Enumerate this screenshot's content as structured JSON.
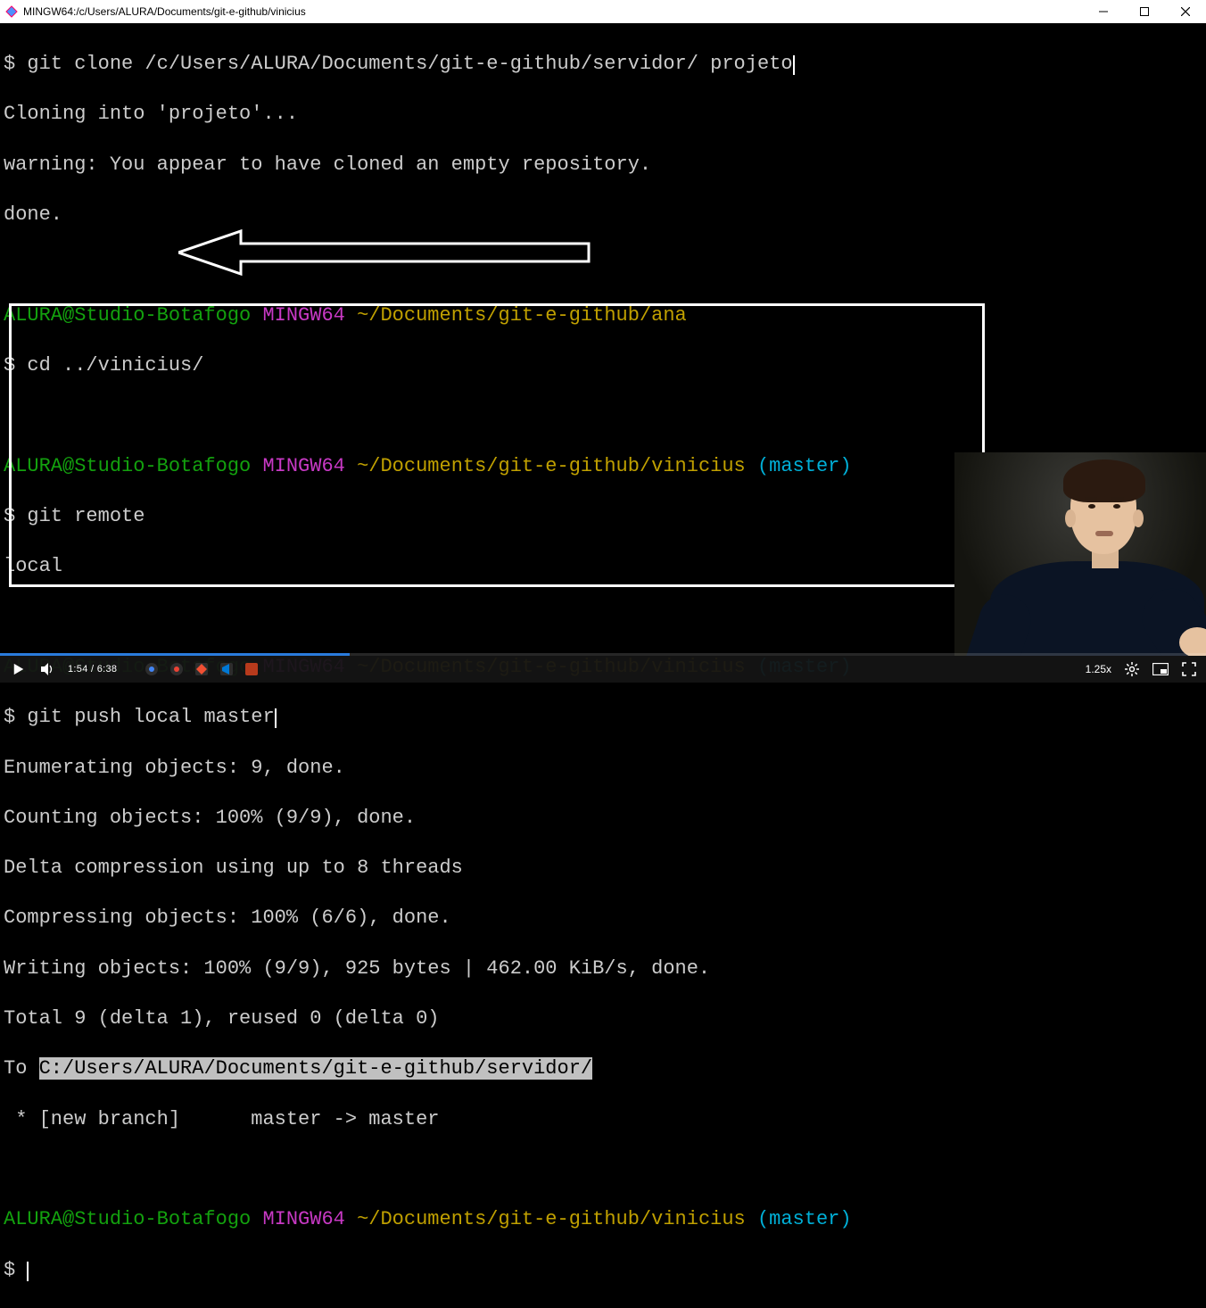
{
  "window": {
    "title": "MINGW64:/c/Users/ALURA/Documents/git-e-github/vinicius"
  },
  "terminal": {
    "line1_prompt": "$ ",
    "line1_cmd": "git clone /c/Users/ALURA/Documents/git-e-github/servidor/ projeto",
    "line2": "Cloning into 'projeto'...",
    "line3": "warning: You appear to have cloned an empty repository.",
    "line4": "done.",
    "blank1": " ",
    "p1_user": "ALURA@Studio-Botafogo",
    "p1_sys": " MINGW64",
    "p1_path": " ~/Documents/git-e-github/ana",
    "p1_cmd_prompt": "$ ",
    "p1_cmd": "cd ../vinicius/",
    "blank2": " ",
    "p2_user": "ALURA@Studio-Botafogo",
    "p2_sys": " MINGW64",
    "p2_path": " ~/Documents/git-e-github/vinicius",
    "p2_branch": " (master)",
    "p2_cmd_prompt": "$ ",
    "p2_cmd": "git remote",
    "p2_out": "local",
    "blank3": " ",
    "p3_user": "ALURA@Studio-Botafogo",
    "p3_sys": " MINGW64",
    "p3_path": " ~/Documents/git-e-github/vinicius",
    "p3_branch": " (master)",
    "p3_cmd_prompt": "$ ",
    "p3_cmd": "git push local master",
    "push1": "Enumerating objects: 9, done.",
    "push2": "Counting objects: 100% (9/9), done.",
    "push3": "Delta compression using up to 8 threads",
    "push4": "Compressing objects: 100% (6/6), done.",
    "push5": "Writing objects: 100% (9/9), 925 bytes | 462.00 KiB/s, done.",
    "push6": "Total 9 (delta 1), reused 0 (delta 0)",
    "push7_pre": "To ",
    "push7_hl": "C:/Users/ALURA/Documents/git-e-github/servidor/",
    "push8": " * [new branch]      master -> master",
    "blank4": " ",
    "p4_user": "ALURA@Studio-Botafogo",
    "p4_sys": " MINGW64",
    "p4_path": " ~/Documents/git-e-github/vinicius",
    "p4_branch": " (master)",
    "p4_prompt": "$ "
  },
  "video": {
    "current_time": "1:54",
    "separator": " / ",
    "duration": "6:38",
    "speed": "1.25x",
    "progress_percent": 29
  }
}
